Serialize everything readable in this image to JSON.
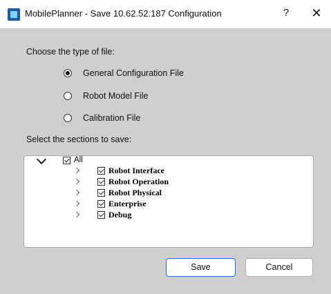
{
  "window": {
    "title": "MobilePlanner - Save 10.62.52.187 Configuration",
    "help_label": "?",
    "close_label": "✕"
  },
  "file_type": {
    "label": "Choose the type of file:",
    "options": [
      {
        "label": "General Configuration File",
        "selected": true
      },
      {
        "label": "Robot Model File",
        "selected": false
      },
      {
        "label": "Calibration File",
        "selected": false
      }
    ]
  },
  "sections": {
    "label": "Select the sections to save:",
    "root": {
      "label": "All",
      "checked": true,
      "expanded": true
    },
    "items": [
      {
        "label": "Robot Interface",
        "checked": true
      },
      {
        "label": "Robot Operation",
        "checked": true
      },
      {
        "label": "Robot Physical",
        "checked": true
      },
      {
        "label": "Enterprise",
        "checked": true
      },
      {
        "label": "Debug",
        "checked": true
      }
    ]
  },
  "buttons": {
    "save": "Save",
    "cancel": "Cancel"
  },
  "colors": {
    "content_bg": "#cfcfcf",
    "default_button_border": "#2a6fd6"
  }
}
